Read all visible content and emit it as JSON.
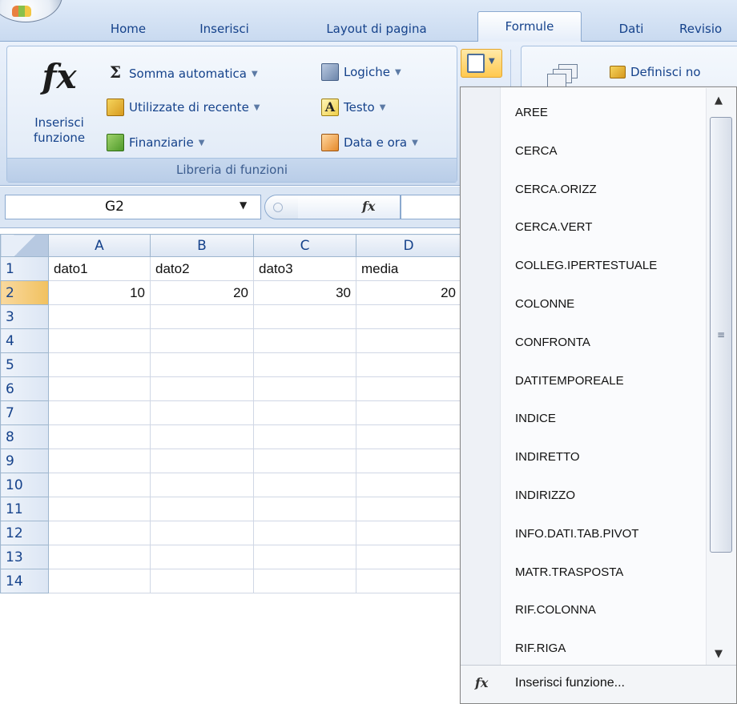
{
  "tabs": [
    "Home",
    "Inserisci",
    "Layout di pagina",
    "Formule",
    "Dati",
    "Revisio"
  ],
  "active_tab": "Formule",
  "ribbon": {
    "insert_function": {
      "glyph": "fx",
      "label": "Inserisci funzione"
    },
    "autosum": "Somma automatica",
    "recent": "Utilizzate di recente",
    "financial": "Finanziarie",
    "logical": "Logiche",
    "text": "Testo",
    "datetime": "Data e ora",
    "group_label": "Libreria di funzioni",
    "define_name": "Definisci no"
  },
  "formula_bar": {
    "name_box": "G2",
    "fx": "fx",
    "formula": ""
  },
  "grid": {
    "columns": [
      "A",
      "B",
      "C",
      "D"
    ],
    "rows": [
      {
        "n": "1",
        "cells": [
          "dato1",
          "dato2",
          "dato3",
          "media"
        ]
      },
      {
        "n": "2",
        "cells": [
          "10",
          "20",
          "30",
          "20"
        ]
      },
      {
        "n": "3",
        "cells": [
          "",
          "",
          "",
          ""
        ]
      },
      {
        "n": "4",
        "cells": [
          "",
          "",
          "",
          ""
        ]
      },
      {
        "n": "5",
        "cells": [
          "",
          "",
          "",
          ""
        ]
      },
      {
        "n": "6",
        "cells": [
          "",
          "",
          "",
          ""
        ]
      },
      {
        "n": "7",
        "cells": [
          "",
          "",
          "",
          ""
        ]
      },
      {
        "n": "8",
        "cells": [
          "",
          "",
          "",
          ""
        ]
      },
      {
        "n": "9",
        "cells": [
          "",
          "",
          "",
          ""
        ]
      },
      {
        "n": "10",
        "cells": [
          "",
          "",
          "",
          ""
        ]
      },
      {
        "n": "11",
        "cells": [
          "",
          "",
          "",
          ""
        ]
      },
      {
        "n": "12",
        "cells": [
          "",
          "",
          "",
          ""
        ]
      },
      {
        "n": "13",
        "cells": [
          "",
          "",
          "",
          ""
        ]
      },
      {
        "n": "14",
        "cells": [
          "",
          "",
          "",
          ""
        ]
      }
    ]
  },
  "dropdown": {
    "items": [
      "AREE",
      "CERCA",
      "CERCA.ORIZZ",
      "CERCA.VERT",
      "COLLEG.IPERTESTUALE",
      "COLONNE",
      "CONFRONTA",
      "DATITEMPOREALE",
      "INDICE",
      "INDIRETTO",
      "INDIRIZZO",
      "INFO.DATI.TAB.PIVOT",
      "MATR.TRASPOSTA",
      "RIF.COLONNA",
      "RIF.RIGA"
    ],
    "footer": {
      "glyph": "fx",
      "label": "Inserisci funzione..."
    }
  }
}
